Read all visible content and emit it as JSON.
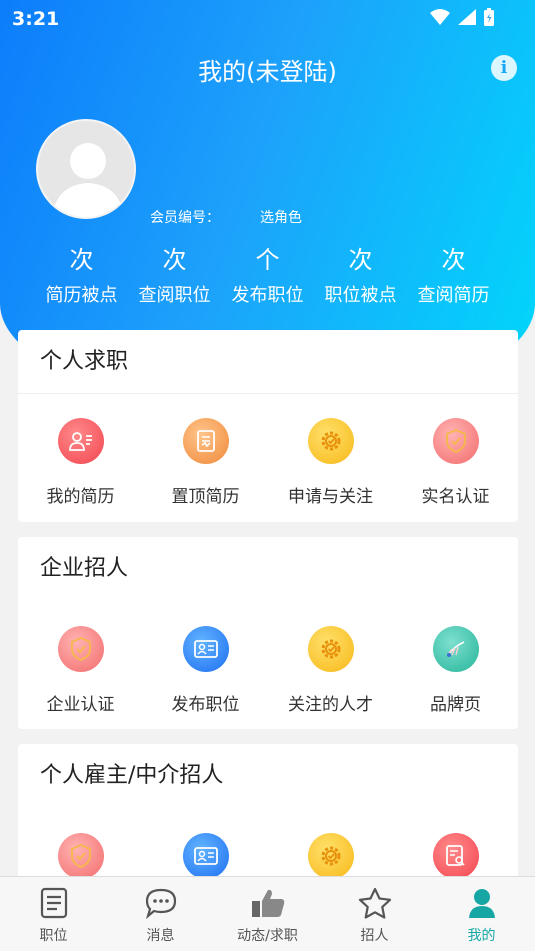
{
  "status_bar": {
    "time": "3:21"
  },
  "header": {
    "title": "我的(未登陆)",
    "info_icon": "info-icon"
  },
  "profile": {
    "member_no_label": "会员编号：",
    "role_select": "选角色"
  },
  "stats": [
    {
      "unit": "次",
      "label": "简历被点"
    },
    {
      "unit": "次",
      "label": "查阅职位"
    },
    {
      "unit": "个",
      "label": "发布职位"
    },
    {
      "unit": "次",
      "label": "职位被点"
    },
    {
      "unit": "次",
      "label": "查阅简历"
    }
  ],
  "sections": [
    {
      "title": "个人求职",
      "items": [
        {
          "label": "我的简历",
          "icon": "resume-icon"
        },
        {
          "label": "置顶简历",
          "icon": "document-icon"
        },
        {
          "label": "申请与关注",
          "icon": "gear-icon"
        },
        {
          "label": "实名认证",
          "icon": "shield-icon"
        }
      ]
    },
    {
      "title": "企业招人",
      "items": [
        {
          "label": "企业认证",
          "icon": "shield-icon"
        },
        {
          "label": "发布职位",
          "icon": "id-card-icon"
        },
        {
          "label": "关注的人才",
          "icon": "gear-icon"
        },
        {
          "label": "品牌页",
          "icon": "brand-icon"
        }
      ]
    },
    {
      "title": "个人雇主/中介招人",
      "items": []
    }
  ],
  "bottom_nav": [
    {
      "label": "职位",
      "icon": "job-list-icon"
    },
    {
      "label": "消息",
      "icon": "chat-icon"
    },
    {
      "label": "动态/求职",
      "icon": "thumbs-up-icon"
    },
    {
      "label": "招人",
      "icon": "star-icon"
    },
    {
      "label": "我的",
      "icon": "person-icon",
      "active": true
    }
  ],
  "colors": {
    "accent": "#16a7a5",
    "header_start": "#0c7dfb",
    "header_end": "#00d8fb"
  }
}
